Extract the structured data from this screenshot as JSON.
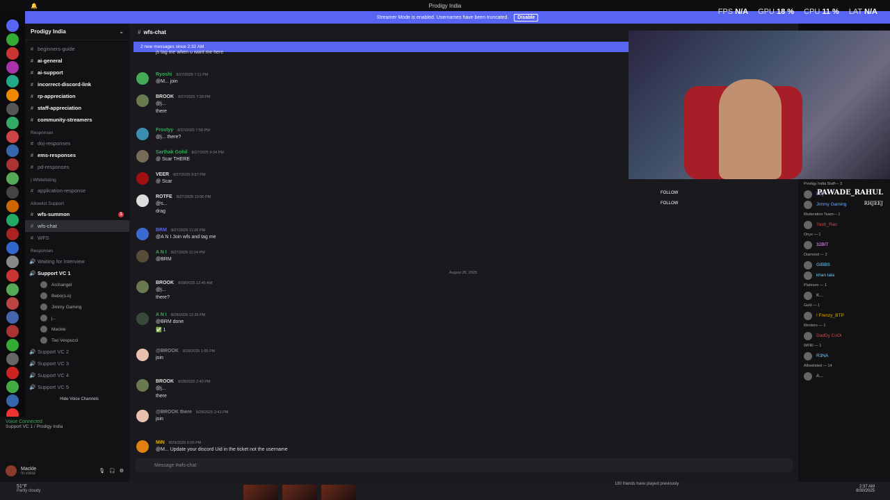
{
  "topbar": {
    "title": "Prodigy India"
  },
  "banner": {
    "text": "Streamer Mode is enabled. Usernames have been truncated.",
    "button": "Disable"
  },
  "stats": {
    "fps_label": "FPS",
    "fps": "N/A",
    "gpu_label": "GPU",
    "gpu": "18 %",
    "cpu_label": "CPU",
    "cpu": "11 %",
    "lat_label": "LAT",
    "lat": "N/A"
  },
  "server": {
    "name": "Prodigy India"
  },
  "channels": [
    {
      "label": "beginners-guide",
      "kind": "text",
      "style": "dim"
    },
    {
      "label": "ai-general",
      "kind": "text",
      "style": "bright"
    },
    {
      "label": "ai-support",
      "kind": "text",
      "style": "bright"
    },
    {
      "label": "incorrect-discord-link",
      "kind": "text",
      "style": "bright"
    },
    {
      "label": "rp-appreciation",
      "kind": "text",
      "style": "bright"
    },
    {
      "label": "staff-appreciation",
      "kind": "text",
      "style": "bright"
    },
    {
      "label": "community-streamers",
      "kind": "text",
      "style": "bright"
    },
    {
      "label": "Responses",
      "kind": "cat"
    },
    {
      "label": "doj-responses",
      "kind": "text",
      "style": "dim"
    },
    {
      "label": "ems-responses",
      "kind": "text",
      "style": "bright"
    },
    {
      "label": "pd-responses",
      "kind": "text",
      "style": "dim"
    },
    {
      "label": "| Whitelisting",
      "kind": "cat"
    },
    {
      "label": "application-response",
      "kind": "text",
      "style": "dim"
    },
    {
      "label": "Allowlist Support",
      "kind": "cat"
    },
    {
      "label": "wfs-summon",
      "kind": "text",
      "style": "bright",
      "badge": "1"
    },
    {
      "label": "wfs-chat",
      "kind": "text",
      "style": "active"
    },
    {
      "label": "WFS",
      "kind": "text",
      "style": "dim"
    },
    {
      "label": "Responses",
      "kind": "cat"
    },
    {
      "label": "Waiting for Interview",
      "kind": "voice",
      "style": "dim"
    },
    {
      "label": "Support VC 1",
      "kind": "voice",
      "style": "bright"
    }
  ],
  "voice_users": [
    "Archangel",
    "Bebo(o.o)",
    "Jimmy Gaming",
    "j...",
    "Mackle",
    "Tao Vespucci"
  ],
  "more_voice": [
    "Support VC 2",
    "Support VC 3",
    "Support VC 4",
    "Support VC 5"
  ],
  "hide_voice": "Hide Voice Channels",
  "voice_connected": {
    "title": "Voice Connected",
    "sub": "Support VC 1 / Prodigy India"
  },
  "user": {
    "name": "Mackle",
    "status": "In voice"
  },
  "chat": {
    "channel": "wfs-chat",
    "new_messages": "2 new messages since 2:32 AM",
    "date_sep": "August 26, 2025",
    "composer_placeholder": "Message #wfs-chat",
    "messages": [
      {
        "name": "",
        "color": "#dbdee1",
        "time": "",
        "l1": "js tag me when u want me here",
        "l2": ""
      },
      {
        "name": "Ryoshi",
        "color": "#3ba55d",
        "time": "8/27/2025 7:11 PM",
        "l1": "@M... join",
        "l2": ""
      },
      {
        "name": "BROOK",
        "color": "#e0e0e0",
        "time": "8/27/2025 7:28 PM",
        "l1": "@j...",
        "l2": "there"
      },
      {
        "name": "Frostyy",
        "color": "#3ba55d",
        "time": "8/27/2025 7:58 PM",
        "l1": "@j... there?",
        "l2": ""
      },
      {
        "name": "Sarthak Gohil",
        "color": "#3ba55d",
        "time": "8/27/2025 9:34 PM",
        "l1": "@ Scar THERE",
        "l2": ""
      },
      {
        "name": "VEER",
        "color": "#e0e0e0",
        "time": "8/27/2025 9:57 PM",
        "l1": "@ Scar",
        "l2": ""
      },
      {
        "name": "ROTFE",
        "color": "#e0e0e0",
        "time": "8/27/2025 10:00 PM",
        "l1": "@s...",
        "l2": "drag"
      },
      {
        "name": "BRM",
        "color": "#5865f2",
        "time": "8/27/2025 11:20 PM",
        "l1": "@A N I  Join wfs and tag me",
        "l2": ""
      },
      {
        "name": "A N I",
        "color": "#3ba55d",
        "time": "8/27/2025 11:24 PM",
        "l1": "@BRM",
        "l2": ""
      },
      {
        "name": "BROOK",
        "color": "#e0e0e0",
        "time": "8/28/2025 12:45 AM",
        "l1": "@j...",
        "l2": "there?"
      },
      {
        "name": "A N I",
        "color": "#3ba55d",
        "time": "8/28/2025 12:29 PM",
        "l1": "@BRM done",
        "l2": "✅ 1"
      },
      {
        "name": "@BROOK",
        "color": "#80848e",
        "time": "8/28/2025 1:55 PM",
        "l1": "join",
        "l2": ""
      },
      {
        "name": "BROOK",
        "color": "#e0e0e0",
        "time": "8/28/2025 2:40 PM",
        "l1": "@j...",
        "l2": "there"
      },
      {
        "name": "@BROOK there",
        "color": "#80848e",
        "time": "8/28/2025 2:41 PM",
        "l1": "join",
        "l2": ""
      },
      {
        "name": "MiN",
        "color": "#e0b000",
        "time": "8/29/2025 6:00 PM",
        "l1": "@M... Update your discord Uid in the ticket not the username",
        "l2": ""
      }
    ]
  },
  "overlay": {
    "follow1": "FOLLOW",
    "follow2": "FOLLOW",
    "name1": "PAWADE_RAHUL",
    "name2": "RHJEEJ"
  },
  "members": [
    {
      "t": "cat",
      "label": "Prodigy India Staff— 3"
    },
    {
      "t": "m",
      "label": "Edy",
      "color": "#8e7cf5"
    },
    {
      "t": "m",
      "label": "Jimmy Gaming",
      "color": "#6fa8ff"
    },
    {
      "t": "cat",
      "label": "Moderation Team— 1"
    },
    {
      "t": "m",
      "label": "Yash_Rao",
      "color": "#e0484a"
    },
    {
      "t": "cat",
      "label": "Onyx — 1"
    },
    {
      "t": "m",
      "label": "32BIT",
      "color": "#f2a0ff"
    },
    {
      "t": "cat",
      "label": "Diamond — 2"
    },
    {
      "t": "m",
      "label": "GIBBS",
      "color": "#6fd0ff"
    },
    {
      "t": "m",
      "label": "khan lala",
      "color": "#6fd0ff"
    },
    {
      "t": "cat",
      "label": "Platinum — 1"
    },
    {
      "t": "m",
      "label": "K...",
      "color": "#bbbbbb"
    },
    {
      "t": "cat",
      "label": "Gold — 1"
    },
    {
      "t": "m",
      "label": "! Frenzy_BTP",
      "color": "#e0b000"
    },
    {
      "t": "cat",
      "label": "Mentors — 1"
    },
    {
      "t": "m",
      "label": "DadDy CoOl",
      "color": "#e0484a"
    },
    {
      "t": "cat",
      "label": "WFBI — 1"
    },
    {
      "t": "m",
      "label": "R3NA",
      "color": "#6fd0ff"
    },
    {
      "t": "cat",
      "label": "Allowlisted — 14"
    },
    {
      "t": "m",
      "label": "A...",
      "color": "#bbbbbb"
    }
  ],
  "taskbar": {
    "weather": "51°F",
    "weather_sub": "Partly cloudy",
    "friends": "180 friends have played previously",
    "time": "2:37 AM",
    "date": "8/30/2025"
  }
}
